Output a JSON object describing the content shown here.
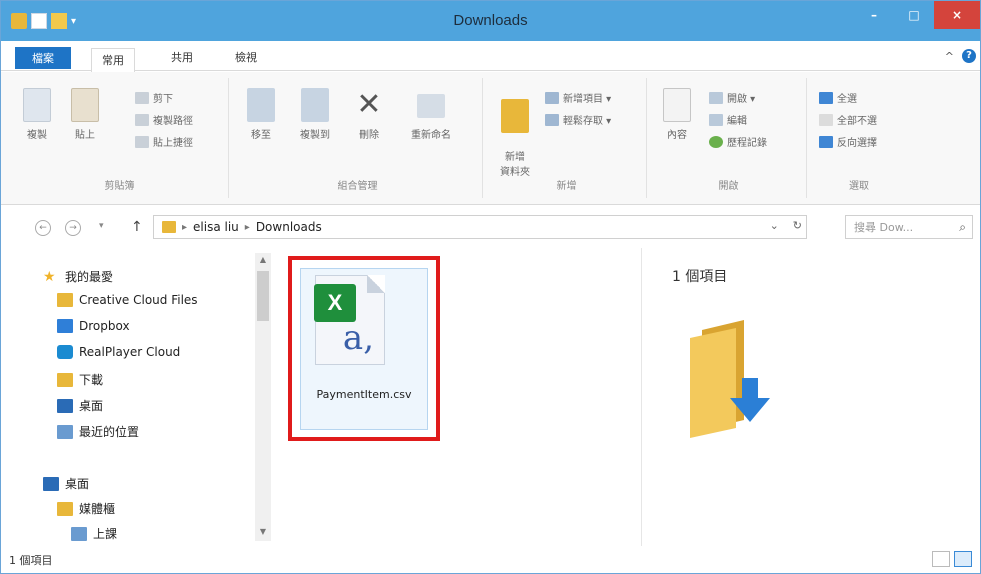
{
  "window": {
    "title": "Downloads"
  },
  "title_controls": {
    "minimize": "–",
    "maximize": "□",
    "close": "×"
  },
  "tabs": {
    "file": "檔案",
    "home": "常用",
    "share": "共用",
    "view": "檢視"
  },
  "help": {
    "collapse": "^",
    "help": "?"
  },
  "ribbon": {
    "clipboard": {
      "label": "剪貼簿",
      "copy": "複製",
      "paste": "貼上",
      "cut": "剪下",
      "copy_path": "複製路徑",
      "paste_shortcut": "貼上捷徑"
    },
    "organize": {
      "label": "組合管理",
      "move_to": "移至",
      "copy_to": "複製到",
      "delete": "刪除",
      "rename": "重新命名"
    },
    "new": {
      "label": "新增",
      "new_folder": "新增\n資料夾",
      "new_item": "新增項目 ▾",
      "easy_access": "輕鬆存取 ▾"
    },
    "open": {
      "label": "開啟",
      "properties": "內容",
      "open": "開啟 ▾",
      "edit": "編輯",
      "history": "歷程記錄"
    },
    "select": {
      "label": "選取",
      "select_all": "全選",
      "select_none": "全部不選",
      "invert": "反向選擇"
    }
  },
  "address": {
    "back": "←",
    "forward": "→",
    "recent": "▾",
    "up": "↑",
    "crumbs": [
      "elisa liu",
      "Downloads"
    ],
    "dropdown": "⌄",
    "refresh": "↻"
  },
  "search": {
    "placeholder": "搜尋 Dow...",
    "icon": "search-icon"
  },
  "navpane": {
    "favorites": [
      {
        "label": "我的最愛",
        "icon": "star-icon",
        "color": "#f0b32a"
      },
      {
        "label": "Creative Cloud Files",
        "icon": "folder-icon",
        "color": "#e8b73a"
      },
      {
        "label": "Dropbox",
        "icon": "dropbox-icon",
        "color": "#2f7fd8"
      },
      {
        "label": "RealPlayer Cloud",
        "icon": "realplayer-icon",
        "color": "#1b8bd1"
      },
      {
        "label": "下載",
        "icon": "downloads-folder-icon",
        "color": "#e8b73a"
      },
      {
        "label": "桌面",
        "icon": "desktop-icon",
        "color": "#2a6bb6"
      },
      {
        "label": "最近的位置",
        "icon": "recent-places-icon",
        "color": "#6a9bd0"
      }
    ],
    "desktop": [
      {
        "label": "桌面",
        "icon": "desktop-icon",
        "color": "#2a6bb6"
      },
      {
        "label": "媒體櫃",
        "icon": "libraries-icon",
        "color": "#e8b73a"
      },
      {
        "label": "上課",
        "icon": "library-item-icon",
        "color": "#6a9bd0"
      }
    ]
  },
  "files": [
    {
      "name": "PaymentItem.csv",
      "type": "csv",
      "badge": "X",
      "glyph": "a,"
    }
  ],
  "preview": {
    "count": "1 個項目"
  },
  "status": {
    "count": "1 個項目"
  }
}
